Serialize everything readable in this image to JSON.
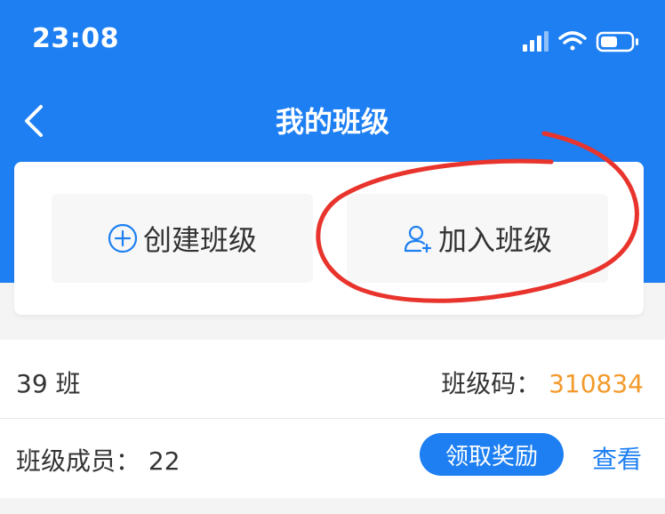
{
  "status_bar": {
    "time": "23:08"
  },
  "nav": {
    "title": "我的班级"
  },
  "actions": {
    "create_label": "创建班级",
    "join_label": "加入班级"
  },
  "class_info": {
    "name": "39 班",
    "code_label": "班级码：",
    "code_value": "310834",
    "members_label": "班级成员：",
    "members_count": "22",
    "reward_label": "领取奖励",
    "view_label": "查看"
  },
  "colors": {
    "primary": "#1d7ff2",
    "accent_orange": "#f39a2c",
    "annotation_red": "#e8342c"
  },
  "icons": [
    "back-arrow-icon",
    "add-circle-icon",
    "add-user-icon",
    "signal-icon",
    "wifi-icon",
    "battery-icon"
  ]
}
